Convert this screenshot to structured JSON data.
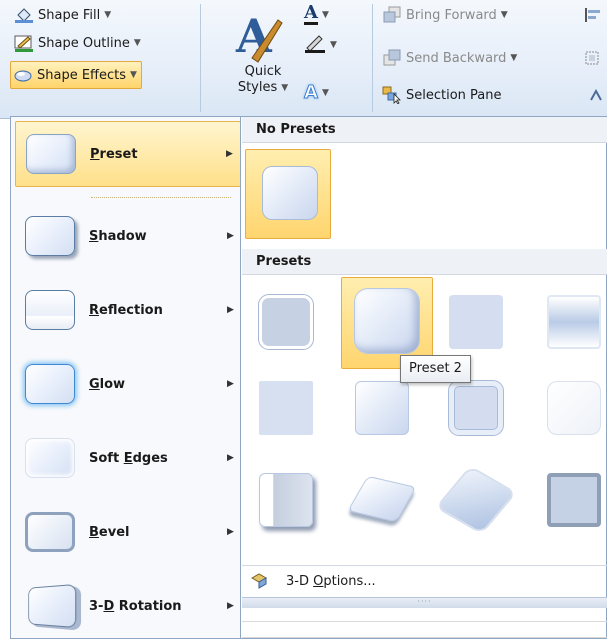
{
  "ribbon": {
    "shape_fill": "Shape Fill",
    "shape_outline": "Shape Outline",
    "shape_effects": "Shape Effects",
    "quick_styles_line1": "Quick",
    "quick_styles_line2": "Styles",
    "bring_forward": "Bring Forward",
    "send_backward": "Send Backward",
    "selection_pane": "Selection Pane",
    "text_fill_letter": "A"
  },
  "effects_menu": {
    "items": [
      {
        "label": "Preset",
        "key": "P"
      },
      {
        "label": "Shadow",
        "key": "S"
      },
      {
        "label": "Reflection",
        "key": "R"
      },
      {
        "label": "Glow",
        "key": "G"
      },
      {
        "label": "Soft Edges",
        "key": "E"
      },
      {
        "label": "Bevel",
        "key": "B"
      },
      {
        "label": "3-D Rotation",
        "key": "D"
      }
    ]
  },
  "gallery": {
    "no_presets_header": "No Presets",
    "presets_header": "Presets",
    "tooltip": "Preset 2",
    "options_label": "3-D Options...",
    "grip": "····"
  },
  "colors": {
    "accent_highlight": "#ffd46a",
    "accent_border": "#e3a93c",
    "ribbon_bg": "#e6eef9"
  }
}
